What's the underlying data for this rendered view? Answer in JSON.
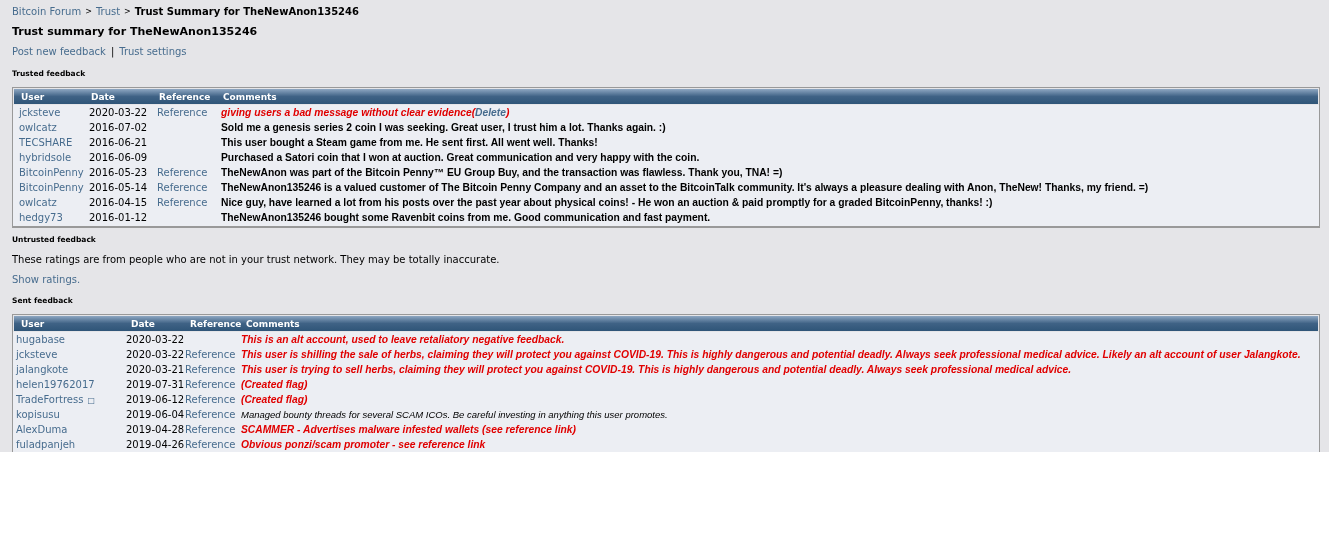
{
  "breadcrumb": [
    {
      "label": "Bitcoin Forum",
      "current": false
    },
    {
      "label": "Trust",
      "current": false
    },
    {
      "label": "Trust Summary for TheNewAnon135246",
      "current": true
    }
  ],
  "breadcrumb_separator": ">",
  "title": "Trust summary for TheNewAnon135246",
  "actions": [
    "Post new feedback",
    "Trust settings"
  ],
  "actions_separator": "|",
  "trusted": {
    "heading": "Trusted feedback",
    "columns": [
      "User",
      "Date",
      "Reference",
      "Comments"
    ],
    "rows": [
      {
        "user": "jcksteve",
        "date": "2020-03-22",
        "reference": "Reference",
        "kind": "negative",
        "comment": "giving users a bad message without clear evidence",
        "link_open": "(",
        "link": "Delete",
        "link_close": ")"
      },
      {
        "user": "owlcatz",
        "date": "2016-07-02",
        "kind": "positive",
        "comment": "Sold me a genesis series 2 coin I was seeking. Great user, I trust him a lot. Thanks again. :)"
      },
      {
        "user": "TECSHARE",
        "date": "2016-06-21",
        "kind": "positive",
        "comment": "This user bought a Steam game from me. He sent first. All went well. Thanks!"
      },
      {
        "user": "hybridsole",
        "date": "2016-06-09",
        "kind": "positive",
        "comment": "Purchased a Satori coin that I won at auction. Great communication and very happy with the coin."
      },
      {
        "user": "BitcoinPenny",
        "date": "2016-05-23",
        "reference": "Reference",
        "kind": "positive",
        "comment": "TheNewAnon was part of the Bitcoin Penny™ EU Group Buy, and the transaction was flawless. Thank you, TNA! =)"
      },
      {
        "user": "BitcoinPenny",
        "date": "2016-05-14",
        "reference": "Reference",
        "kind": "positive",
        "comment": "TheNewAnon135246 is a valued customer of The Bitcoin Penny Company and an asset to the BitcoinTalk community. It's always a pleasure dealing with Anon, TheNew! Thanks, my friend. =)"
      },
      {
        "user": "owlcatz",
        "date": "2016-04-15",
        "reference": "Reference",
        "kind": "positive",
        "comment": "Nice guy, have learned a lot from his posts over the past year about physical coins! - He won an auction & paid promptly for a graded BitcoinPenny, thanks! :)"
      },
      {
        "user": "hedgy73",
        "date": "2016-01-12",
        "kind": "positive",
        "comment": "TheNewAnon135246 bought some Ravenbit coins from me. Good communication and fast payment."
      }
    ]
  },
  "untrusted": {
    "heading": "Untrusted feedback",
    "note": "These ratings are from people who are not in your trust network. They may be totally inaccurate.",
    "link": "Show ratings."
  },
  "sent": {
    "heading": "Sent feedback",
    "columns": [
      "User",
      "Date",
      "Reference",
      "Comments"
    ],
    "rows": [
      {
        "user": "hugabase",
        "date": "2020-03-22",
        "kind": "negative",
        "comment": "This is an alt account, used to leave retaliatory negative feedback."
      },
      {
        "user": "jcksteve",
        "date": "2020-03-22",
        "reference": "Reference",
        "kind": "negative",
        "comment": "This user is shilling the sale of herbs, claiming they will protect you against COVID-19. This is highly dangerous and potential deadly. Always seek professional medical advice. Likely an alt account of user Jalangkote."
      },
      {
        "user": "jalangkote",
        "date": "2020-03-21",
        "reference": "Reference",
        "kind": "negative",
        "comment": "This user is trying to sell herbs, claiming they will protect you against COVID-19. This is highly dangerous and potential deadly. Always seek professional medical advice."
      },
      {
        "user": "helen19762017",
        "date": "2019-07-31",
        "reference": "Reference",
        "kind": "negative",
        "comment": "(Created flag)"
      },
      {
        "user": "TradeFortress",
        "user_mark": "□",
        "date": "2019-06-12",
        "reference": "Reference",
        "kind": "negative",
        "comment": "(Created flag)"
      },
      {
        "user": "kopisusu",
        "date": "2019-06-04",
        "reference": "Reference",
        "kind": "neutral",
        "comment": "Managed bounty threads for several SCAM ICOs. Be careful investing in anything this user promotes."
      },
      {
        "user": "AlexDuma",
        "date": "2019-04-28",
        "reference": "Reference",
        "kind": "negative",
        "comment": "SCAMMER - Advertises malware infested wallets (see reference link)"
      },
      {
        "user": "fuladpanjeh",
        "date": "2019-04-26",
        "reference": "Reference",
        "kind": "negative",
        "comment": "Obvious ponzi/scam promoter - see reference link"
      }
    ]
  }
}
